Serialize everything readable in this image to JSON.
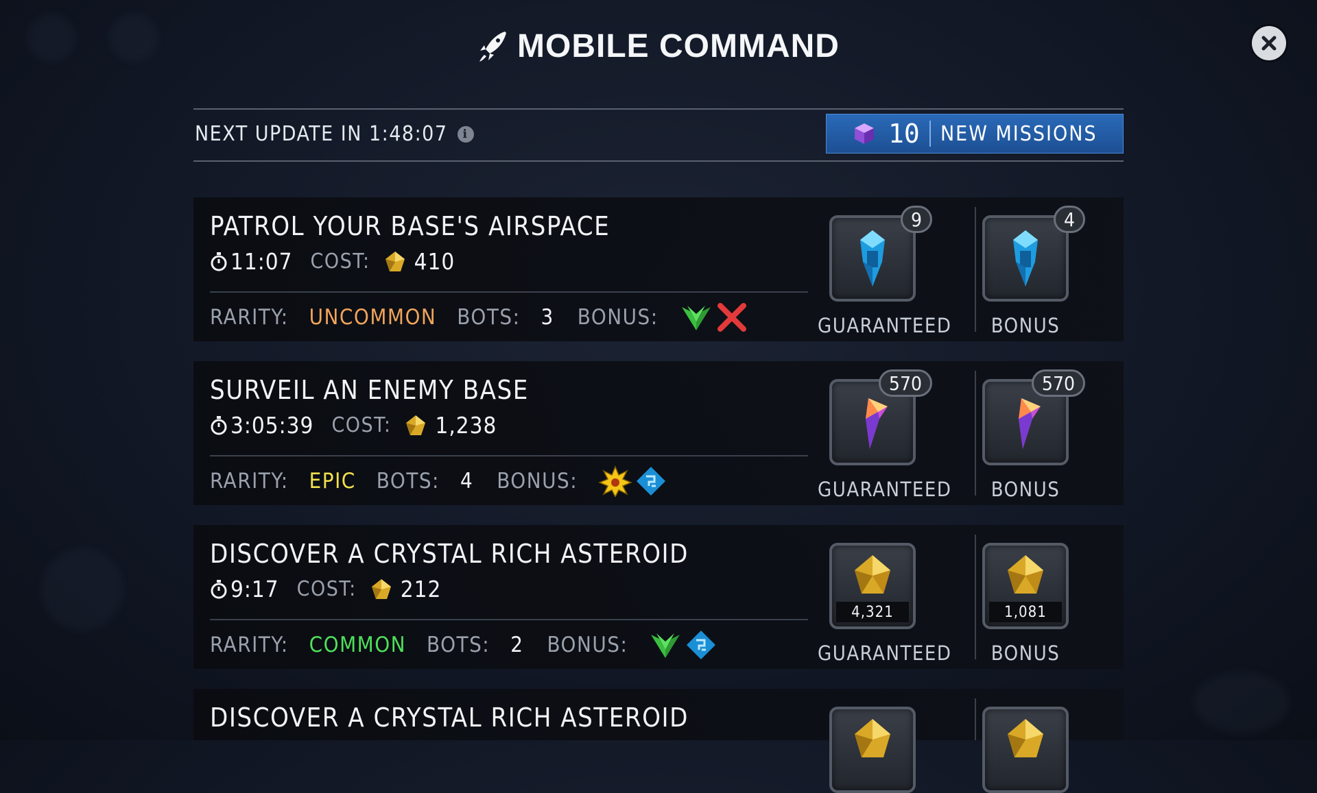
{
  "header": {
    "title": "MOBILE COMMAND",
    "icon": "rocket-icon"
  },
  "update": {
    "text": "NEXT UPDATE IN 1:48:07",
    "info_glyph": "i",
    "missions_count": "10",
    "missions_label": "NEW MISSIONS"
  },
  "labels": {
    "cost": "COST:",
    "rarity": "RARITY:",
    "bots": "BOTS:",
    "bonus": "BONUS:",
    "guaranteed": "GUARANTEED",
    "bonus_reward": "BONUS"
  },
  "colors": {
    "uncommon": "#f0a45a",
    "epic": "#f2e04c",
    "common": "#4fe05a",
    "missions_button": "#2a6ab8"
  },
  "missions": [
    {
      "title": "PATROL YOUR BASE'S AIRSPACE",
      "time": "11:07",
      "cost": "410",
      "rarity": "UNCOMMON",
      "bots": "3",
      "bonus_icons": [
        "green-wings-icon",
        "red-x-icon"
      ],
      "guaranteed": {
        "icon": "blue-chip-icon",
        "count": "9"
      },
      "bonus": {
        "icon": "blue-chip-icon",
        "count": "4"
      }
    },
    {
      "title": "SURVEIL AN ENEMY BASE",
      "time": "3:05:39",
      "cost": "1,238",
      "rarity": "EPIC",
      "bots": "4",
      "bonus_icons": [
        "yellow-burst-icon",
        "blue-circuit-icon"
      ],
      "guaranteed": {
        "icon": "crystal-shard-icon",
        "count": "570"
      },
      "bonus": {
        "icon": "crystal-shard-icon",
        "count": "570"
      }
    },
    {
      "title": "DISCOVER A CRYSTAL RICH ASTEROID",
      "time": "9:17",
      "cost": "212",
      "rarity": "COMMON",
      "bots": "2",
      "bonus_icons": [
        "green-wings-icon",
        "blue-circuit-icon"
      ],
      "guaranteed": {
        "icon": "gold-ore-icon",
        "qty": "4,321"
      },
      "bonus": {
        "icon": "gold-ore-icon",
        "qty": "1,081"
      }
    },
    {
      "title": "DISCOVER A CRYSTAL RICH ASTEROID"
    }
  ]
}
